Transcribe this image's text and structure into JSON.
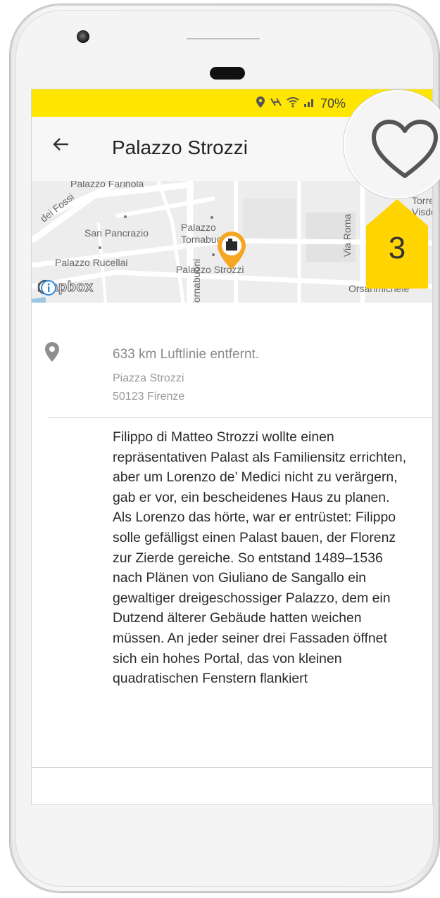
{
  "status_bar": {
    "battery": "70%"
  },
  "header": {
    "title": "Palazzo Strozzi",
    "back_icon": "arrow-left-icon"
  },
  "map": {
    "labels": {
      "farinola": "Palazzo Farinola",
      "fossi": "dei Fossi",
      "san_pancrazio": "San Pancrazio",
      "palazzo_tornab": "Palazzo Tornabuoni",
      "rucellai": "Palazzo Rucellai",
      "strozzi": "Palazzo Strozzi",
      "via_roma": "Via Roma",
      "torre": "Torre Visdomini",
      "orsanmichele": "Orsanmichele",
      "tornabuoni_street": "Tornabuoni",
      "mapbox": "mapbox"
    }
  },
  "location": {
    "distance": "633 km Luftlinie entfernt.",
    "street": "Piazza Strozzi",
    "city": "50123 Firenze"
  },
  "description": "Filippo di Matteo Strozzi wollte einen repräsentativen Palast als Familiensitz errichten, aber um Lorenzo de’ Medici nicht zu verärgern, gab er vor, ein bescheidenes Haus zu planen. Als Lorenzo das hörte, war er entrüstet: Filippo solle gefälligst einen Palast bauen, der Florenz zur Zierde gereiche. So entstand 1489–1536 nach Plänen von Giuliano de Sangallo ein gewaltiger dreigeschossiger Palazzo, dem ein Dutzend älterer Gebäude hatten weichen müssen. An jeder seiner drei Fassaden öffnet sich ein hohes Portal, das von kleinen quadratischen Fenstern flankiert",
  "annotation": {
    "step_number": "3",
    "color": "#ffd400"
  },
  "colors": {
    "status_bar": "#ffe600",
    "marker": "#f5a623"
  }
}
